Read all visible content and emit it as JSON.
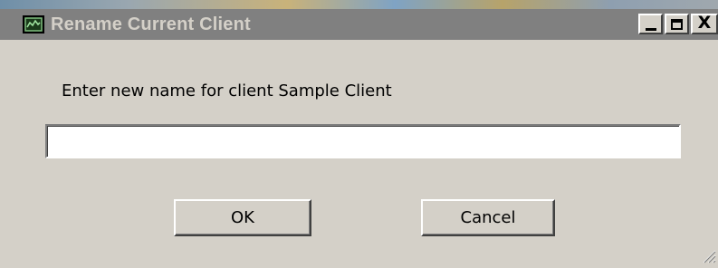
{
  "window": {
    "title": "Rename Current Client",
    "app_icon": "monitor-chart-icon",
    "controls": {
      "minimize_icon": "minimize-icon",
      "maximize_icon": "maximize-icon",
      "close_glyph": "X"
    },
    "colors": {
      "titlebar_inactive": "#808080",
      "title_text": "#d4d0c8",
      "face": "#d4d0c8"
    }
  },
  "dialog": {
    "prompt": "Enter new name for client Sample Client",
    "name_input": {
      "value": "",
      "placeholder": ""
    },
    "buttons": {
      "ok_label": "OK",
      "cancel_label": "Cancel"
    }
  }
}
